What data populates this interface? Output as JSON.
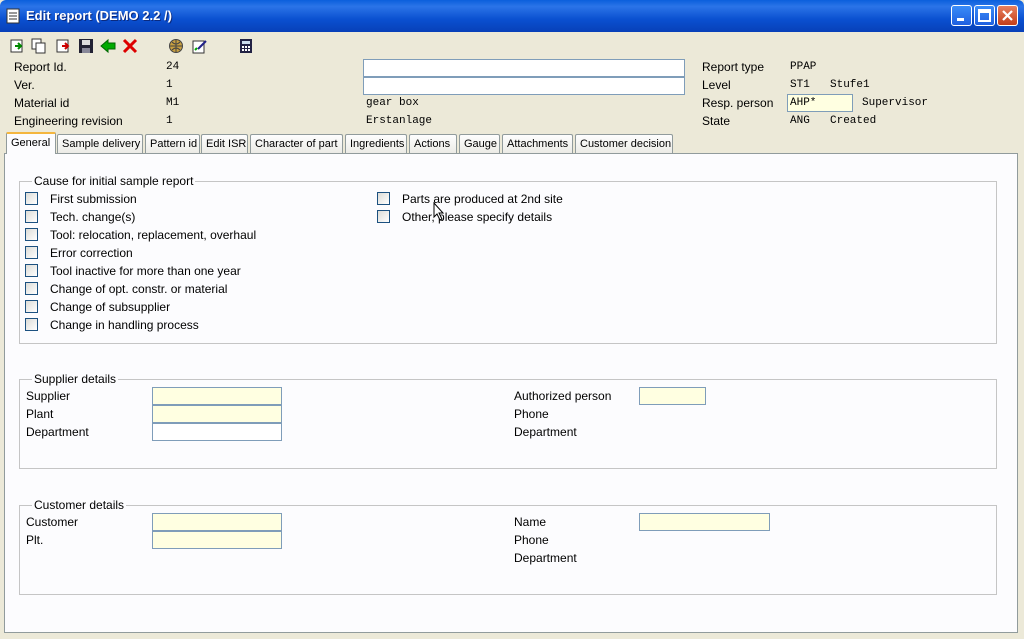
{
  "window": {
    "title": "Edit report (DEMO 2.2 /)"
  },
  "toolbar": {
    "icons": [
      "new-icon",
      "copy-icon",
      "export-icon",
      "save-icon",
      "back-arrow-icon",
      "delete-icon",
      "globe-icon",
      "edit-icon",
      "calculator-icon"
    ]
  },
  "header": {
    "report_id_label": "Report Id.",
    "report_id_value": "24",
    "ver_label": "Ver.",
    "ver_value": "1",
    "material_label": "Material id",
    "material_value": "M1",
    "material_desc": "gear box",
    "eng_rev_label": "Engineering revision",
    "eng_rev_value": "1",
    "eng_rev_desc": "Erstanlage",
    "report_type_label": "Report type",
    "report_type_value": "PPAP",
    "level_label": "Level",
    "level_value": "ST1",
    "level_desc": "Stufe1",
    "resp_label": "Resp. person",
    "resp_value": "AHP*",
    "resp_desc": "Supervisor",
    "state_label": "State",
    "state_value": "ANG",
    "state_desc": "Created"
  },
  "tabs": [
    "General",
    "Sample delivery",
    "Pattern id",
    "Edit ISR",
    "Character of part",
    "Ingredients",
    "Actions",
    "Gauge",
    "Attachments",
    "Customer decision"
  ],
  "cause": {
    "title": "Cause for initial sample report",
    "left": [
      "First submission",
      "Tech. change(s)",
      "Tool: relocation, replacement, overhaul",
      "Error correction",
      "Tool inactive for more than one year",
      "Change of opt. constr. or material",
      "Change of subsupplier",
      "Change in handling process"
    ],
    "right": [
      "Parts are produced at 2nd site",
      "Other, please specify details"
    ]
  },
  "supplier": {
    "title": "Supplier details",
    "supplier_label": "Supplier",
    "plant_label": "Plant",
    "dept_label": "Department",
    "auth_label": "Authorized person",
    "phone_label": "Phone",
    "dept2_label": "Department"
  },
  "customer": {
    "title": "Customer details",
    "customer_label": "Customer",
    "plt_label": "Plt.",
    "name_label": "Name",
    "phone_label": "Phone",
    "dept_label": "Department"
  }
}
